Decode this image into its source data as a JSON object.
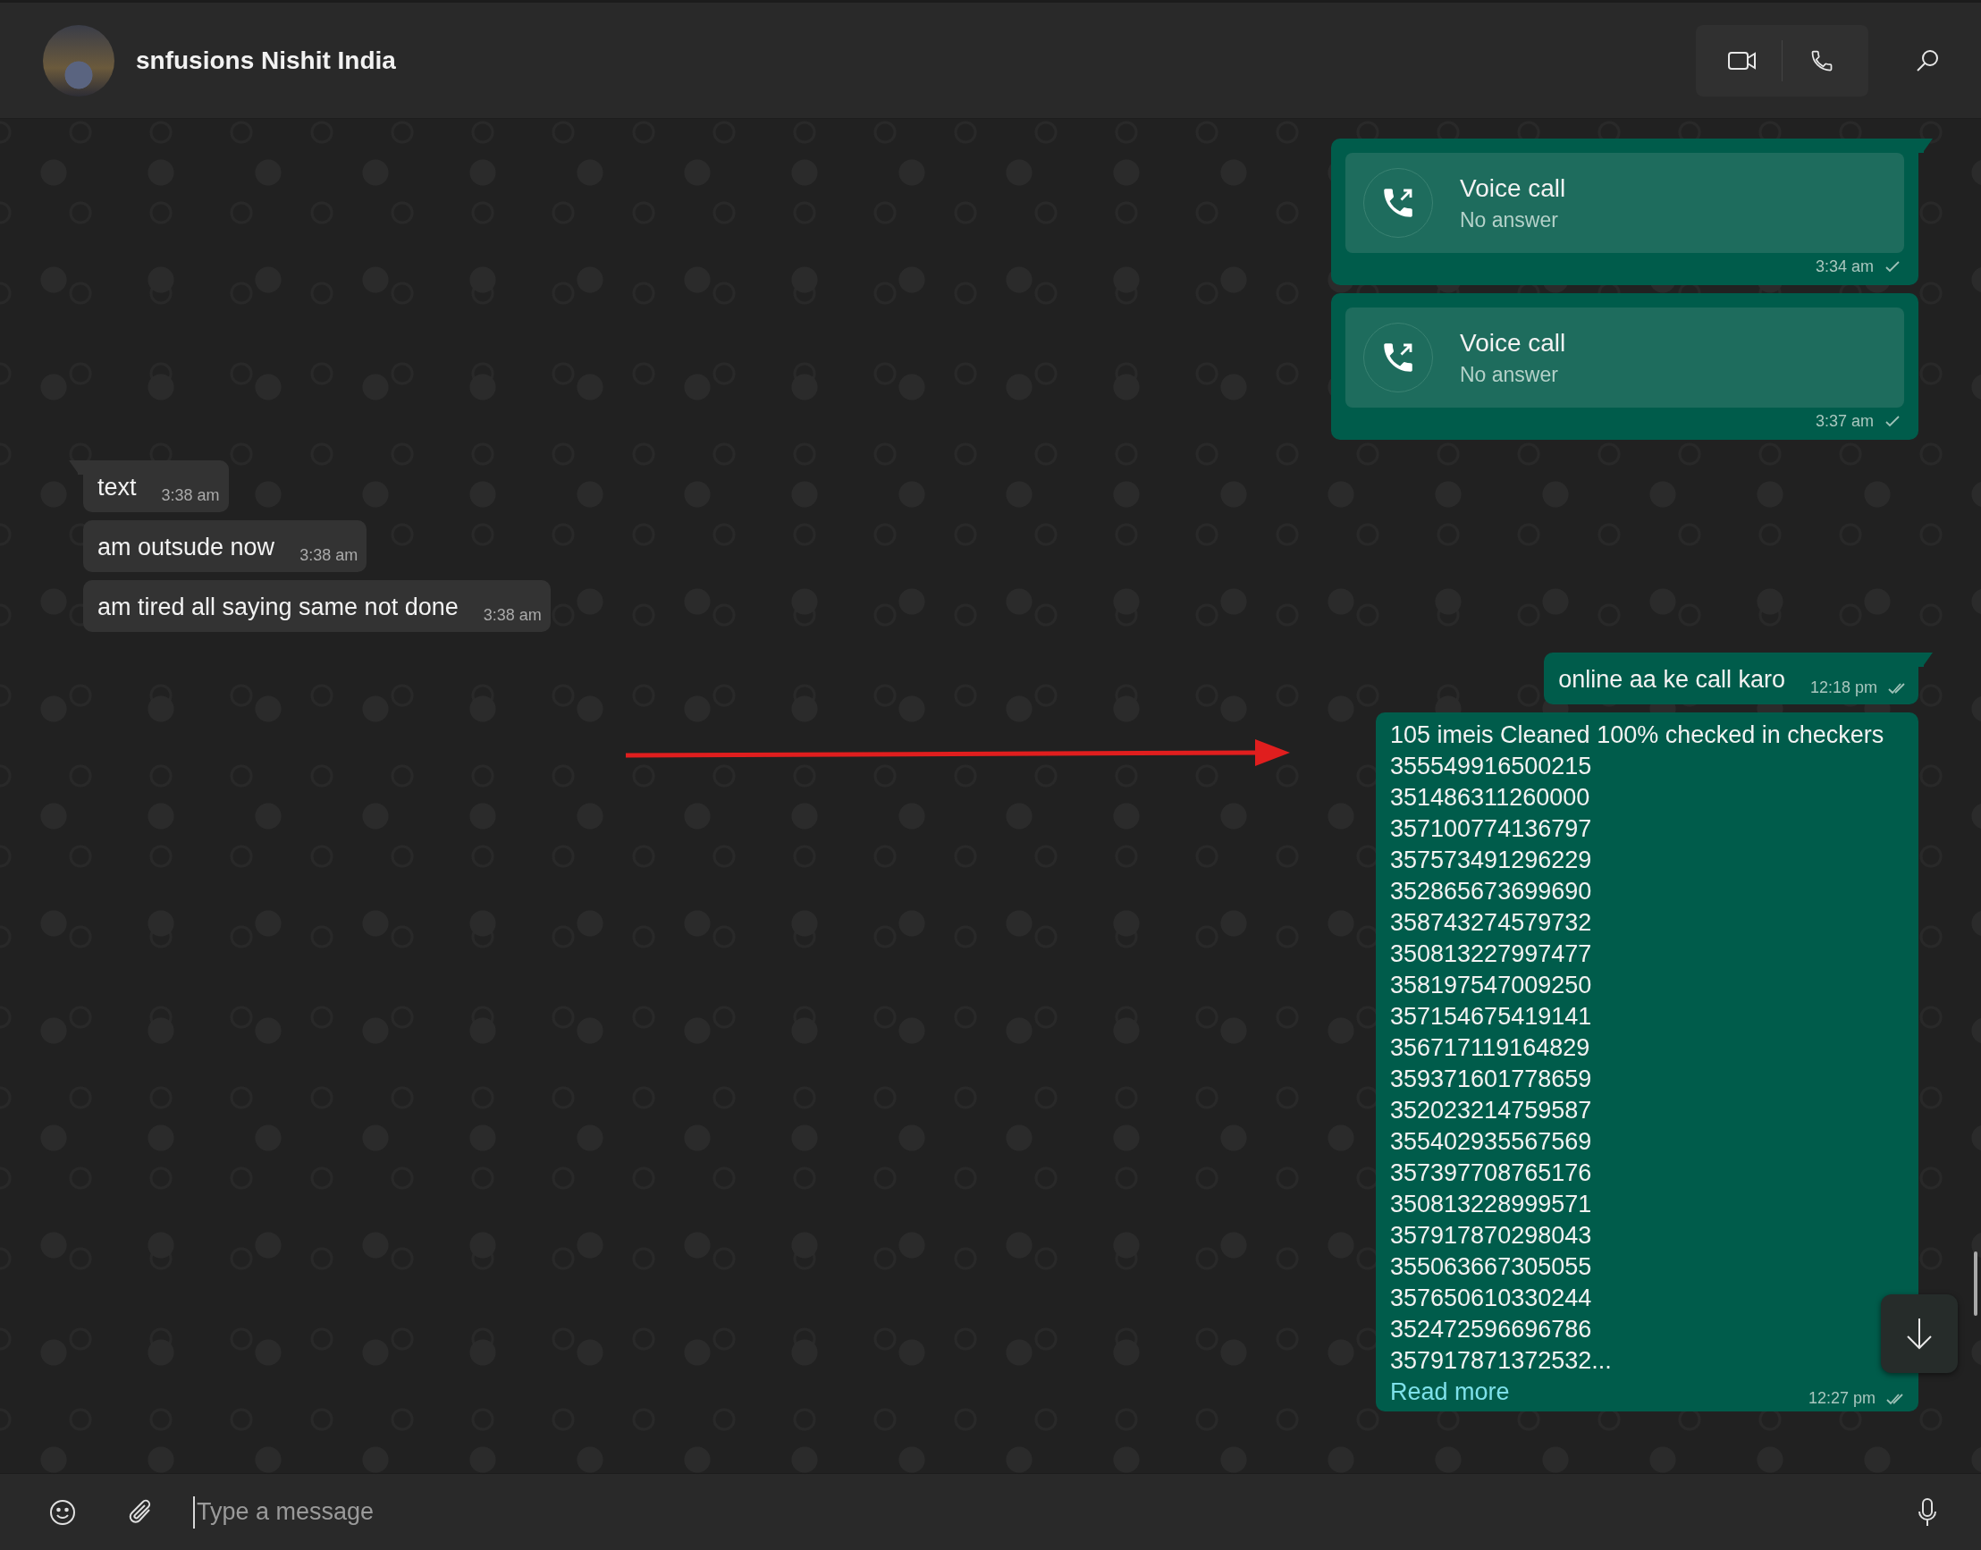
{
  "chat": {
    "contact_name": "snfusions Nishit India"
  },
  "messages": [
    {
      "kind": "call",
      "outgoing": true,
      "title": "Voice call",
      "subtitle": "No answer",
      "time": "3:34 am",
      "delivered": false
    },
    {
      "kind": "call",
      "outgoing": true,
      "title": "Voice call",
      "subtitle": "No answer",
      "time": "3:37 am",
      "delivered": false
    },
    {
      "kind": "text",
      "outgoing": false,
      "text": "text",
      "time": "3:38 am"
    },
    {
      "kind": "text",
      "outgoing": false,
      "text": "am outsude now",
      "time": "3:38 am"
    },
    {
      "kind": "text",
      "outgoing": false,
      "text": "am tired all saying same not done",
      "time": "3:38 am"
    },
    {
      "kind": "text",
      "outgoing": true,
      "text": "online aa ke call karo",
      "time": "12:18 pm",
      "delivered": true
    },
    {
      "kind": "long",
      "outgoing": true,
      "lines": [
        "105 imeis Cleaned 100% checked in checkers",
        "355549916500215",
        "351486311260000",
        "357100774136797",
        "357573491296229",
        "352865673699690",
        "358743274579732",
        "350813227997477",
        "358197547009250",
        "357154675419141",
        "356717119164829",
        "359371601778659",
        "352023214759587",
        "355402935567569",
        "357397708765176",
        "350813228999571",
        "357917870298043",
        "355063667305055",
        "357650610330244",
        "352472596696786",
        "357917871372532..."
      ],
      "read_more": "Read more",
      "time": "12:27 pm",
      "delivered": true
    }
  ],
  "composer": {
    "placeholder": "Type a message"
  }
}
